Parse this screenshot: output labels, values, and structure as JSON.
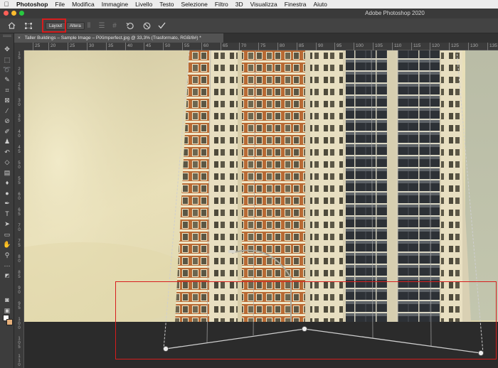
{
  "menubar": {
    "apple": "",
    "items": [
      "Photoshop",
      "File",
      "Modifica",
      "Immagine",
      "Livello",
      "Testo",
      "Selezione",
      "Filtro",
      "3D",
      "Visualizza",
      "Finestra",
      "Aiuto"
    ]
  },
  "window": {
    "title": "Adobe Photoshop 2020"
  },
  "options_bar": {
    "layout_label": "Layout",
    "altera_label": "Altera"
  },
  "document": {
    "tab_close": "×",
    "tab_title": "Taller Buildings – Sample Image – PiXimperfect.jpg @ 33,3% (Trasformato, RGB/8#) *"
  },
  "rulers": {
    "h_ticks": [
      "25",
      "20",
      "25",
      "30",
      "35",
      "40",
      "45",
      "50",
      "55",
      "60",
      "65",
      "70",
      "75",
      "80",
      "85",
      "90",
      "95",
      "100",
      "105",
      "110",
      "115",
      "120",
      "125",
      "130",
      "135"
    ],
    "v_ticks": [
      "1\n5",
      "2\n0",
      "2\n5",
      "3\n0",
      "3\n5",
      "4\n0",
      "4\n5",
      "5\n0",
      "5\n5",
      "6\n0",
      "6\n5",
      "7\n0",
      "7\n5",
      "8\n0",
      "8\n5",
      "9\n0",
      "9\n5",
      "1\n0\n0",
      "1\n0\n5",
      "1\n1\n0"
    ]
  },
  "colors": {
    "foreground": "#ffffff",
    "background": "#e7b07a",
    "highlight": "#d71d1d"
  },
  "tools": [
    "move-icon",
    "marquee-icon",
    "lasso-icon",
    "quick-select-icon",
    "crop-icon",
    "frame-icon",
    "eyedropper-icon",
    "healing-icon",
    "brush-icon",
    "stamp-icon",
    "history-brush-icon",
    "eraser-icon",
    "gradient-icon",
    "blur-icon",
    "dodge-icon",
    "pen-icon",
    "type-icon",
    "path-select-icon",
    "rectangle-icon",
    "hand-icon",
    "zoom-icon",
    "more-icon"
  ]
}
